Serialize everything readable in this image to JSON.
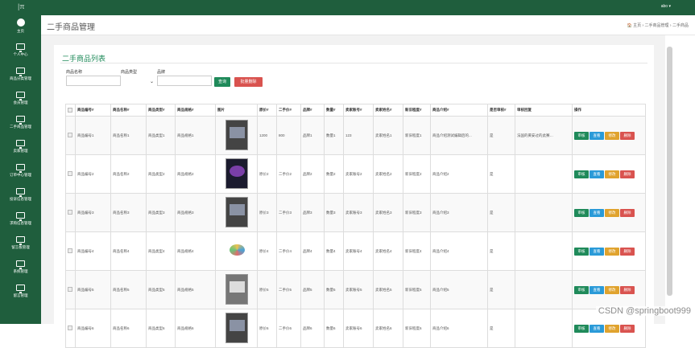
{
  "topbar": {
    "logo": "|π",
    "user": "abo ▾"
  },
  "sidebar": [
    {
      "label": "主页",
      "icon": "home-icon"
    },
    {
      "label": "个人中心",
      "icon": "monitor-icon"
    },
    {
      "label": "商品分类管理",
      "icon": "monitor-icon"
    },
    {
      "label": "会员管理",
      "icon": "monitor-icon"
    },
    {
      "label": "二手商品管理",
      "icon": "monitor-icon"
    },
    {
      "label": "卖家管理",
      "icon": "monitor-icon"
    },
    {
      "label": "订单中心管理",
      "icon": "monitor-icon"
    },
    {
      "label": "投诉信息管理",
      "icon": "monitor-icon"
    },
    {
      "label": "求购信息管理",
      "icon": "monitor-icon"
    },
    {
      "label": "留言板管理",
      "icon": "monitor-icon"
    },
    {
      "label": "系统管理",
      "icon": "monitor-icon"
    },
    {
      "label": "留言管理",
      "icon": "monitor-icon"
    }
  ],
  "header": {
    "title": "二手商品管理",
    "breadcrumb": "🏠 主页 › 二手商品管理 › 二手商品"
  },
  "panel": {
    "title": "二手商品列表",
    "filters": {
      "name_label": "商品名称",
      "type_label": "商品类型",
      "brand_label": "品牌"
    },
    "search_btn": "查询",
    "batch_delete_btn": "批量删除"
  },
  "table": {
    "headers": [
      "",
      "商品编号#",
      "商品名称#",
      "商品类型#",
      "商品规格#",
      "图片",
      "原价#",
      "二手价#",
      "品牌#",
      "数量#",
      "卖家账号#",
      "卖家姓名#",
      "新旧程度#",
      "商品介绍#",
      "是否审核#",
      "审核回复",
      "操作"
    ],
    "rows": [
      [
        "商品编号1",
        "商品名称1",
        "商品类型1",
        "商品规格1",
        "1200",
        "800",
        "品牌1",
        "数量1",
        "123",
        "卖家姓名1",
        "新旧程度1",
        "商品介绍测试编辑后的...",
        "是",
        "法国的黄安过的此赛…"
      ],
      [
        "商品编号2",
        "商品名称2",
        "商品类型2",
        "商品规格2",
        "原价2",
        "二手价2",
        "品牌2",
        "数量2",
        "卖家账号2",
        "卖家姓名2",
        "新旧程度2",
        "商品介绍2",
        "是",
        ""
      ],
      [
        "商品编号3",
        "商品名称3",
        "商品类型3",
        "商品规格3",
        "原价3",
        "二手价3",
        "品牌3",
        "数量3",
        "卖家账号3",
        "卖家姓名3",
        "新旧程度3",
        "商品介绍3",
        "是",
        ""
      ],
      [
        "商品编号4",
        "商品名称4",
        "商品类型4",
        "商品规格4",
        "原价4",
        "二手价4",
        "品牌4",
        "数量4",
        "卖家账号4",
        "卖家姓名4",
        "新旧程度4",
        "商品介绍4",
        "是",
        ""
      ],
      [
        "商品编号5",
        "商品名称5",
        "商品类型5",
        "商品规格5",
        "原价5",
        "二手价5",
        "品牌5",
        "数量5",
        "卖家账号5",
        "卖家姓名5",
        "新旧程度5",
        "商品介绍5",
        "是",
        ""
      ],
      [
        "商品编号6",
        "商品名称6",
        "商品类型6",
        "商品规格6",
        "原价6",
        "二手价6",
        "品牌6",
        "数量6",
        "卖家账号6",
        "卖家姓名6",
        "新旧程度6",
        "商品介绍6",
        "是",
        ""
      ]
    ],
    "ops": {
      "audit": "审核",
      "view": "查看",
      "edit": "修改",
      "delete": "删除"
    }
  },
  "watermark": "CSDN @springboot999",
  "colors": {
    "brand_green": "#1f5e3d",
    "accent_green": "#1f8a5a",
    "danger": "#d9534f",
    "info": "#2a9ad8",
    "warn": "#e0a32e"
  }
}
